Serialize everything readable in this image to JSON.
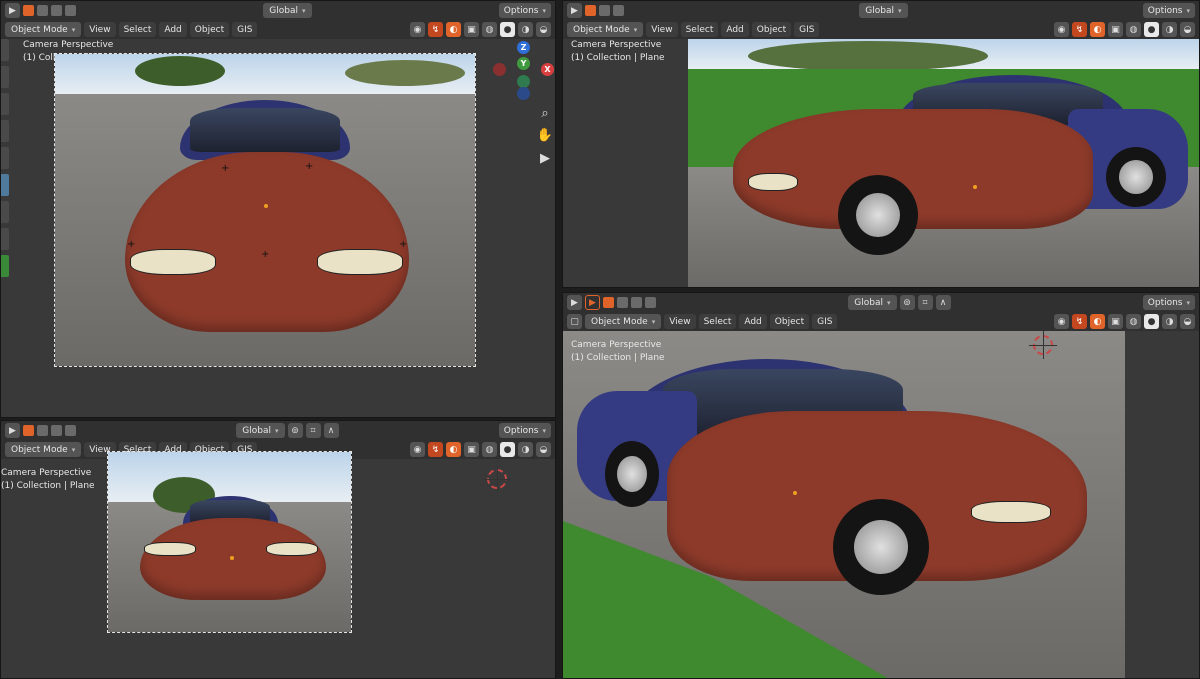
{
  "header": {
    "mode_label": "Object Mode",
    "menus": [
      "View",
      "Select",
      "Add",
      "Object",
      "GIS"
    ],
    "orientation_label": "Global",
    "options_label": "Options"
  },
  "overlay": {
    "camera_label": "Camera Perspective",
    "collection_label": "(1) Collection | Plane"
  },
  "gizmo": {
    "z": "Z",
    "y": "Y",
    "x": "X"
  },
  "icons": [
    "camera-icon",
    "grab-icon",
    "zoom-icon",
    "cursor-icon",
    "snap-icon",
    "proportional-icon"
  ],
  "colors": {
    "accent": "#e0642a",
    "car_red": "#8d3a2a",
    "car_blue": "#2d3370",
    "header": "#303030",
    "viewport": "#393939"
  }
}
